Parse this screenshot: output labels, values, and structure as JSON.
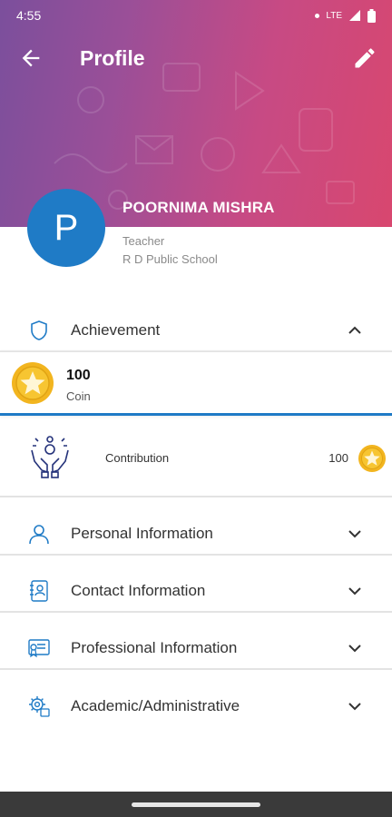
{
  "status": {
    "time": "4:55",
    "network": "LTE"
  },
  "header": {
    "title": "Profile"
  },
  "profile": {
    "initial": "P",
    "name": "POORNIMA MISHRA",
    "role": "Teacher",
    "school": "R D Public School"
  },
  "achievement": {
    "label": "Achievement",
    "coin": {
      "value": "100",
      "label": "Coin"
    },
    "contribution": {
      "label": "Contribution",
      "value": "100"
    }
  },
  "sections": [
    {
      "label": "Personal Information",
      "icon": "person-icon"
    },
    {
      "label": "Contact Information",
      "icon": "contact-book-icon"
    },
    {
      "label": "Professional Information",
      "icon": "certificate-icon"
    },
    {
      "label": "Academic/Administrative",
      "icon": "settings-icon"
    }
  ],
  "colors": {
    "accent": "#1f7bc6",
    "coin": "#f2b51f",
    "gradient_start": "#7b4f9c",
    "gradient_end": "#d8476f"
  }
}
